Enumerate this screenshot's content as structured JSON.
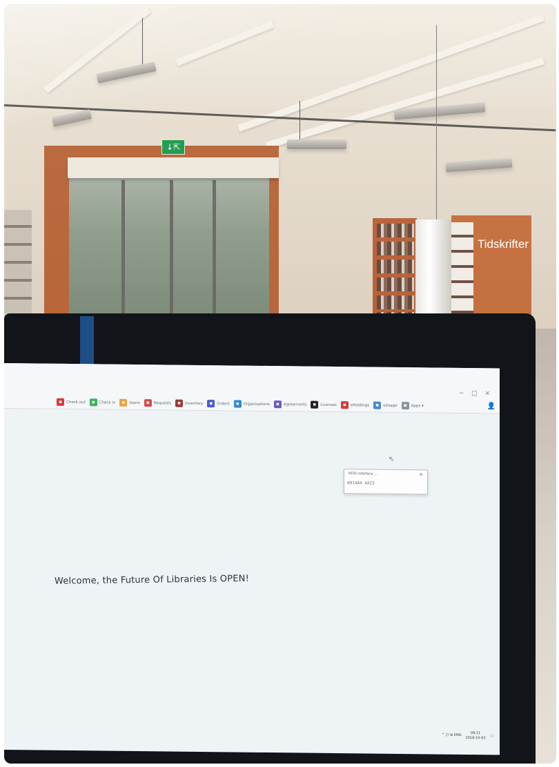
{
  "scene": {
    "sign_text": "Tidskrifter",
    "exit_sign": "↓⇱"
  },
  "browser": {
    "window_controls": "− □ ×",
    "toolbar": [
      {
        "label": "Check out",
        "icon": "check-out-icon",
        "color": "#d9383a"
      },
      {
        "label": "Check in",
        "icon": "check-in-icon",
        "color": "#3bb35a"
      },
      {
        "label": "Users",
        "icon": "users-icon",
        "color": "#f0a23a"
      },
      {
        "label": "Requests",
        "icon": "requests-icon",
        "color": "#d84a4a"
      },
      {
        "label": "Inventory",
        "icon": "inventory-icon",
        "color": "#9c3a3a"
      },
      {
        "label": "Orders",
        "icon": "orders-icon",
        "color": "#4a5bd0"
      },
      {
        "label": "Organizations",
        "icon": "organizations-icon",
        "color": "#2d8ad6"
      },
      {
        "label": "Agreements",
        "icon": "agreements-icon",
        "color": "#6b59c9"
      },
      {
        "label": "Licenses",
        "icon": "licenses-icon",
        "color": "#222222"
      },
      {
        "label": "eHoldings",
        "icon": "eholdings-icon",
        "color": "#d23a3a"
      },
      {
        "label": "eUsage",
        "icon": "eusage-icon",
        "color": "#4a8ad2"
      },
      {
        "label": "Apps ▾",
        "icon": "apps-icon",
        "color": "#8a94a0"
      }
    ],
    "user_icon": "👤"
  },
  "dialog": {
    "title": "RFID interface ...",
    "close": "×",
    "body": "0014A4 4A23"
  },
  "main": {
    "welcome": "Welcome, the Future Of Libraries Is OPEN!"
  },
  "taskbar": {
    "tray": "^ 🗊 ⊕ ENG",
    "time": "09:21",
    "date": "2018-10-03",
    "notifications": "🗨"
  }
}
